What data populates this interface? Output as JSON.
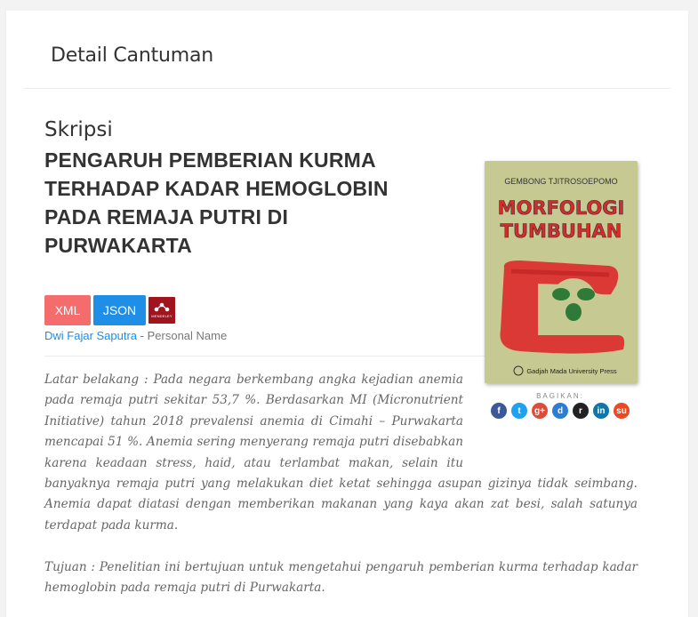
{
  "header": {
    "title": "Detail Cantuman"
  },
  "record": {
    "type": "Skripsi",
    "title": "PENGARUH PEMBERIAN KURMA TERHADAP KADAR HEMOGLOBIN PADA REMAJA PUTRI DI PURWAKARTA",
    "export": {
      "xml_label": "XML",
      "json_label": "JSON",
      "mendeley_label": "MENDELEY"
    },
    "author": {
      "name": "Dwi Fajar Saputra",
      "role": "- Personal Name"
    },
    "abstract": {
      "p1": "Latar belakang : Pada negara berkembang angka kejadian anemia pada remaja putri sekitar 53,7 %. Berdasarkan MI (Micronutrient Initiative) tahun 2018 prevalensi anemia di Cimahi – Purwakarta mencapai 51 %. Anemia sering menyerang remaja putri disebabkan karena keadaan stress, haid, atau terlambat makan, selain itu banyaknya remaja putri yang melakukan diet ketat sehingga asupan gizinya tidak seimbang. Anemia dapat diatasi dengan memberikan makanan yang kaya akan zat besi, salah satunya terdapat pada kurma.",
      "p2": "Tujuan : Penelitian ini bertujuan untuk mengetahui pengaruh pemberian kurma terhadap kadar hemoglobin pada remaja putri di Purwakarta."
    }
  },
  "cover": {
    "author": "GEMBONG TJITROSOEPOMO",
    "title_line1": "MORFOLOGI",
    "title_line2": "TUMBUHAN",
    "publisher": "Gadjah Mada University Press"
  },
  "share": {
    "label": "BAGIKAN:",
    "icons": [
      {
        "name": "facebook-icon",
        "glyph": "f",
        "color": "#3b5998"
      },
      {
        "name": "twitter-icon",
        "glyph": "t",
        "color": "#1da1f2"
      },
      {
        "name": "google-plus-icon",
        "glyph": "g+",
        "color": "#dd4b39"
      },
      {
        "name": "digg-icon",
        "glyph": "d",
        "color": "#2d7dd2"
      },
      {
        "name": "reddit-icon",
        "glyph": "r",
        "color": "#222222"
      },
      {
        "name": "linkedin-icon",
        "glyph": "in",
        "color": "#0e76a8"
      },
      {
        "name": "stumbleupon-icon",
        "glyph": "su",
        "color": "#eb4924"
      }
    ]
  }
}
